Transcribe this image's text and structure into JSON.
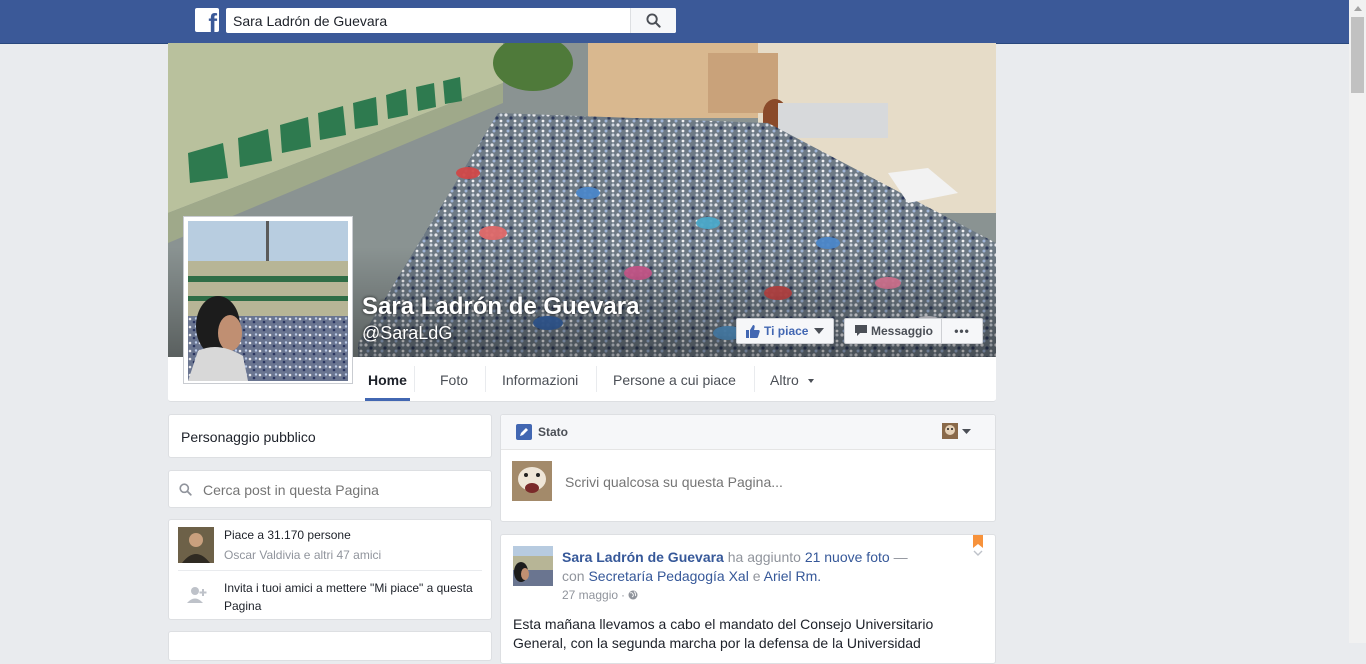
{
  "search": {
    "value": "Sara Ladrón de Guevara"
  },
  "page": {
    "name": "Sara Ladrón de Guevara",
    "handle": "@SaraLdG"
  },
  "actions": {
    "like_label": "Ti piace",
    "message_label": "Messaggio",
    "more_label": "•••"
  },
  "tabs": [
    "Home",
    "Foto",
    "Informazioni",
    "Persone a cui piace",
    "Altro"
  ],
  "left": {
    "category": "Personaggio pubblico",
    "search_placeholder": "Cerca post in questa Pagina",
    "likes_text": "Piace a 31.170 persone",
    "friends_text": "Oscar Valdivia e altri 47 amici",
    "invite_text": "Invita i tuoi amici a mettere \"Mi piace\" a questa Pagina"
  },
  "composer": {
    "tab_label": "Stato",
    "placeholder": "Scrivi qualcosa su questa Pagina..."
  },
  "post": {
    "author": "Sara Ladrón de Guevara",
    "action": "ha aggiunto",
    "photos": "21 nuove foto",
    "dash": "—",
    "with_prefix": "con",
    "tag1": "Secretaría Pedagogía Xal",
    "and": "e",
    "tag2": "Ariel Rm.",
    "date": "27 maggio",
    "dot": "·",
    "body_line1": "Esta mañana llevamos a cabo el mandato del Consejo Universitario",
    "body_line2": "General, con la segunda marcha por la defensa de la Universidad"
  },
  "colors": {
    "topbar": "#3b5998",
    "link": "#365899",
    "accent": "#4267b2",
    "background": "#e9ebee"
  }
}
